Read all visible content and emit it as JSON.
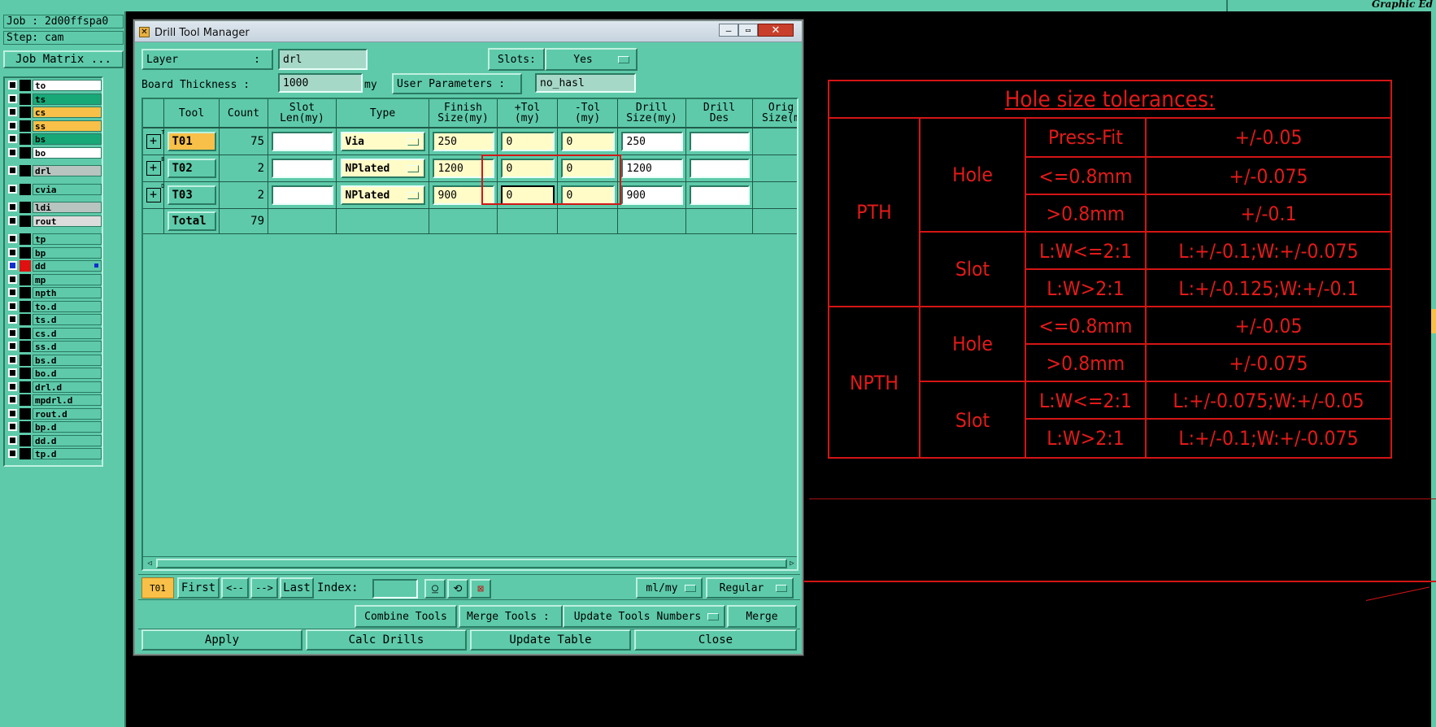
{
  "top_bar": {
    "right_text": "Graphic Ed"
  },
  "job_panel": {
    "job_label": "Job : 2d00ffspa0",
    "step_label": "Step: cam",
    "matrix_button": "Job Matrix ..."
  },
  "layers": [
    {
      "name": "to",
      "bg": "#ffffff"
    },
    {
      "name": "ts",
      "bg": "#18a878"
    },
    {
      "name": "cs",
      "bg": "#f8c048"
    },
    {
      "name": "ss",
      "bg": "#f8c048"
    },
    {
      "name": "bs",
      "bg": "#18a878"
    },
    {
      "name": "bo",
      "bg": "#ffffff"
    },
    {
      "name": "drl",
      "bg": "#b8c4c0"
    },
    {
      "name": "cvia",
      "bg": "#5ecaa9"
    },
    {
      "name": "ldi",
      "bg": "#b8c4c0"
    },
    {
      "name": "rout",
      "bg": "#dcdcdc"
    },
    {
      "name": "tp",
      "bg": "#5ecaa9"
    },
    {
      "name": "bp",
      "bg": "#5ecaa9"
    },
    {
      "name": "dd",
      "bg": "#5ecaa9"
    },
    {
      "name": "mp",
      "bg": "#5ecaa9"
    },
    {
      "name": "npth",
      "bg": "#5ecaa9"
    },
    {
      "name": "to.d",
      "bg": "#5ecaa9"
    },
    {
      "name": "ts.d",
      "bg": "#5ecaa9"
    },
    {
      "name": "cs.d",
      "bg": "#5ecaa9"
    },
    {
      "name": "ss.d",
      "bg": "#5ecaa9"
    },
    {
      "name": "bs.d",
      "bg": "#5ecaa9"
    },
    {
      "name": "bo.d",
      "bg": "#5ecaa9"
    },
    {
      "name": "drl.d",
      "bg": "#5ecaa9"
    },
    {
      "name": "mpdrl.d",
      "bg": "#5ecaa9"
    },
    {
      "name": "rout.d",
      "bg": "#5ecaa9"
    },
    {
      "name": "bp.d",
      "bg": "#5ecaa9"
    },
    {
      "name": "dd.d",
      "bg": "#5ecaa9"
    },
    {
      "name": "tp.d",
      "bg": "#5ecaa9"
    }
  ],
  "dialog": {
    "title": "Drill Tool Manager",
    "layer_label": "Layer",
    "layer_colon": ":",
    "layer_value": "drl",
    "slots_label": "Slots:",
    "slots_value": "Yes",
    "thickness_label": "Board Thickness :",
    "thickness_value": "1000",
    "thickness_unit": "my",
    "user_params_label": "User Parameters :",
    "user_params_value": "no_hasl",
    "headers": [
      "Tool",
      "Count",
      "Slot\nLen(my)",
      "Type",
      "Finish\nSize(my)",
      "+Tol\n(my)",
      "-Tol\n(my)",
      "Drill\nSize(my)",
      "Drill\nDes",
      "Orig\nSize(m"
    ],
    "rows": [
      {
        "tool": "T01",
        "count": "75",
        "slot_len": "",
        "type": "Via",
        "finish": "250",
        "ptol": "0",
        "ntol": "0",
        "drill": "250",
        "des": "",
        "marker": "T"
      },
      {
        "tool": "T02",
        "count": "2",
        "slot_len": "",
        "type": "NPlated",
        "finish": "1200",
        "ptol": "0",
        "ntol": "0",
        "drill": "1200",
        "des": "",
        "marker": "B"
      },
      {
        "tool": "T03",
        "count": "2",
        "slot_len": "",
        "type": "NPlated",
        "finish": "900",
        "ptol": "0",
        "ntol": "0",
        "drill": "900",
        "des": "",
        "marker": "D"
      }
    ],
    "total_label": "Total",
    "total_count": "79",
    "nav": {
      "current": "T01",
      "first": "First",
      "prev": "<--",
      "next": "-->",
      "last": "Last",
      "index_label": "Index:",
      "units": "ml/my",
      "mode": "Regular"
    },
    "actions": {
      "combine": "Combine Tools",
      "merge_label": "Merge Tools :",
      "merge_option": "Update Tools Numbers",
      "merge_button": "Merge"
    },
    "bottom": {
      "apply": "Apply",
      "calc": "Calc Drills",
      "update": "Update Table",
      "close": "Close"
    }
  },
  "tolerance_table": {
    "title": "Hole size tolerances:",
    "pth": "PTH",
    "npth": "NPTH",
    "hole": "Hole",
    "slot": "Slot",
    "rows": [
      {
        "cond": "Press-Fit",
        "tol": "+/-0.05"
      },
      {
        "cond": "<=0.8mm",
        "tol": "+/-0.075"
      },
      {
        "cond": ">0.8mm",
        "tol": "+/-0.1"
      },
      {
        "cond": "L:W<=2:1",
        "tol": "L:+/-0.1;W:+/-0.075"
      },
      {
        "cond": "L:W>2:1",
        "tol": "L:+/-0.125;W:+/-0.1"
      },
      {
        "cond": "<=0.8mm",
        "tol": "+/-0.05"
      },
      {
        "cond": ">0.8mm",
        "tol": "+/-0.075"
      },
      {
        "cond": "L:W<=2:1",
        "tol": "L:+/-0.075;W:+/-0.05"
      },
      {
        "cond": "L:W>2:1",
        "tol": "L:+/-0.1;W:+/-0.075"
      }
    ]
  }
}
